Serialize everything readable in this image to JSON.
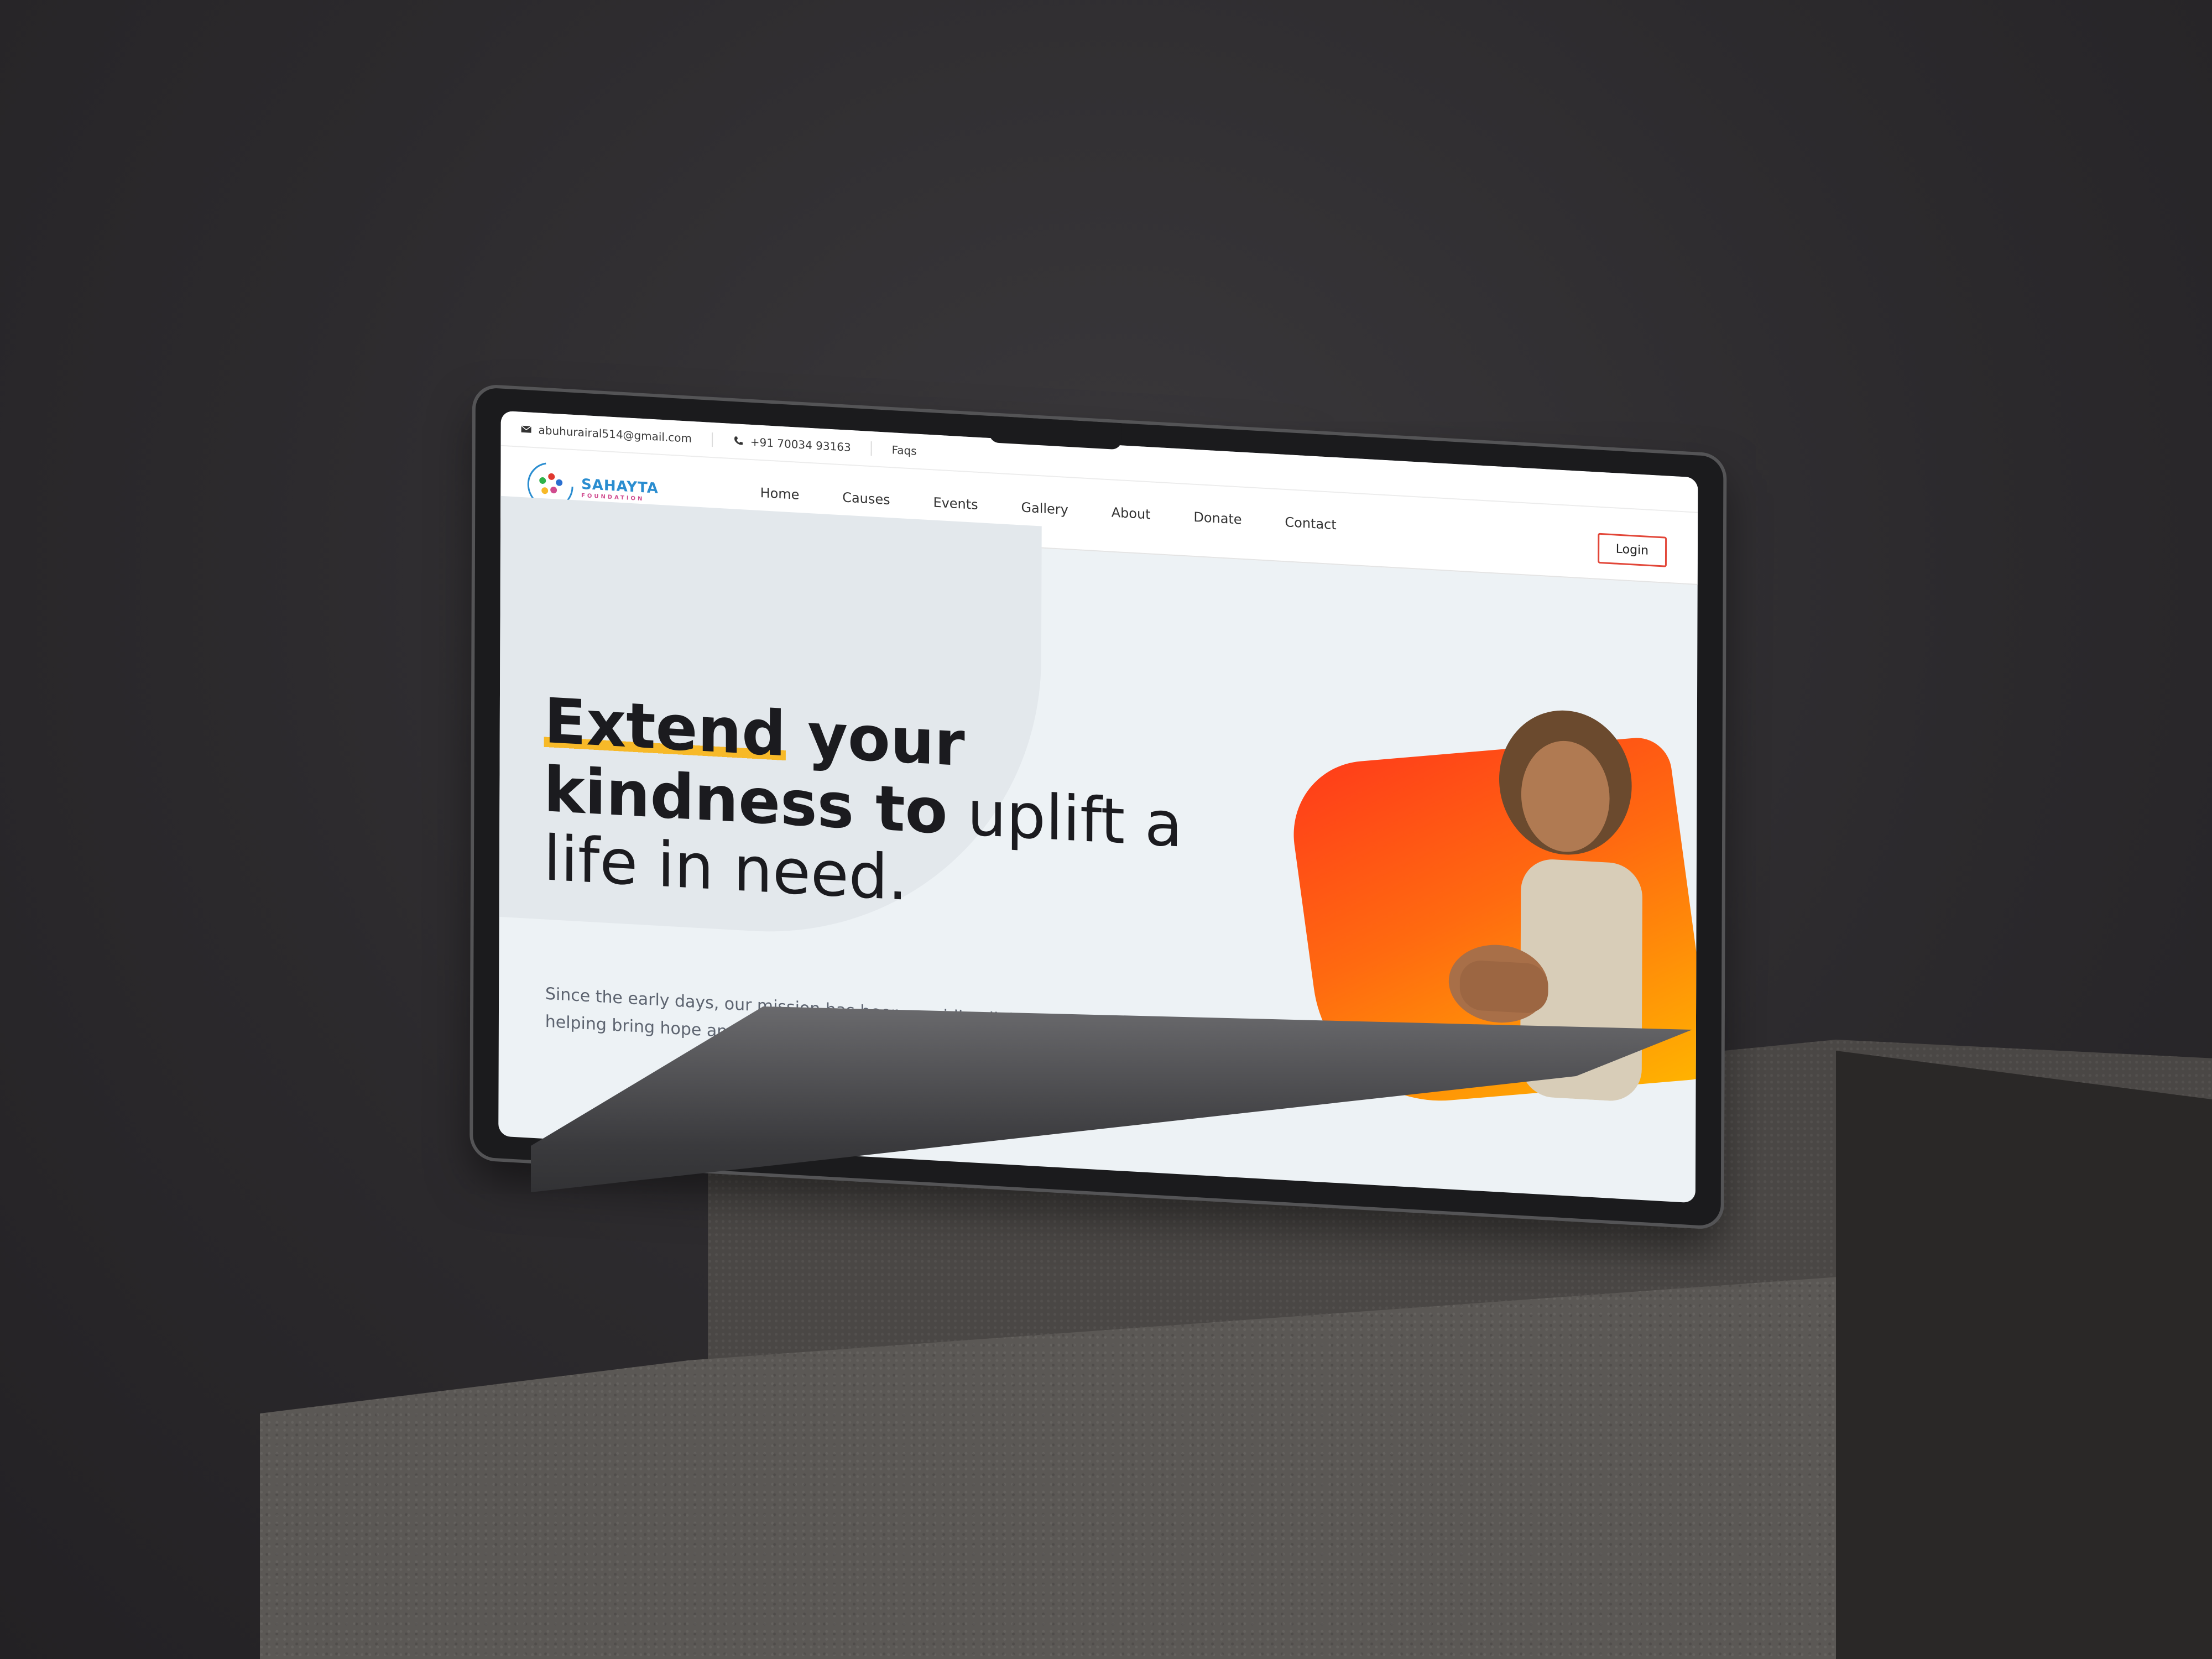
{
  "topbar": {
    "email": "abuhurairal514@gmail.com",
    "phone": "+91 70034 93163",
    "faqs": "Faqs"
  },
  "logo": {
    "name": "SAHAYTA",
    "subtitle": "FOUNDATION"
  },
  "nav": {
    "items": [
      {
        "label": "Home"
      },
      {
        "label": "Causes"
      },
      {
        "label": "Events"
      },
      {
        "label": "Gallery"
      },
      {
        "label": "About"
      },
      {
        "label": "Donate"
      },
      {
        "label": "Contact"
      }
    ],
    "login_label": "Login"
  },
  "hero": {
    "title_w1": "Extend",
    "title_w2": " your",
    "title_w3": "kindness to",
    "title_w4": " uplift a",
    "title_w5": "life in need.",
    "description": "Since the early days, our mission has been a guiding light for those in need, helping bring hope and change"
  },
  "colors": {
    "accent": "#e24638",
    "highlight": "#f7b928",
    "shape_start": "#ff3b1a",
    "shape_end": "#ffb400"
  }
}
